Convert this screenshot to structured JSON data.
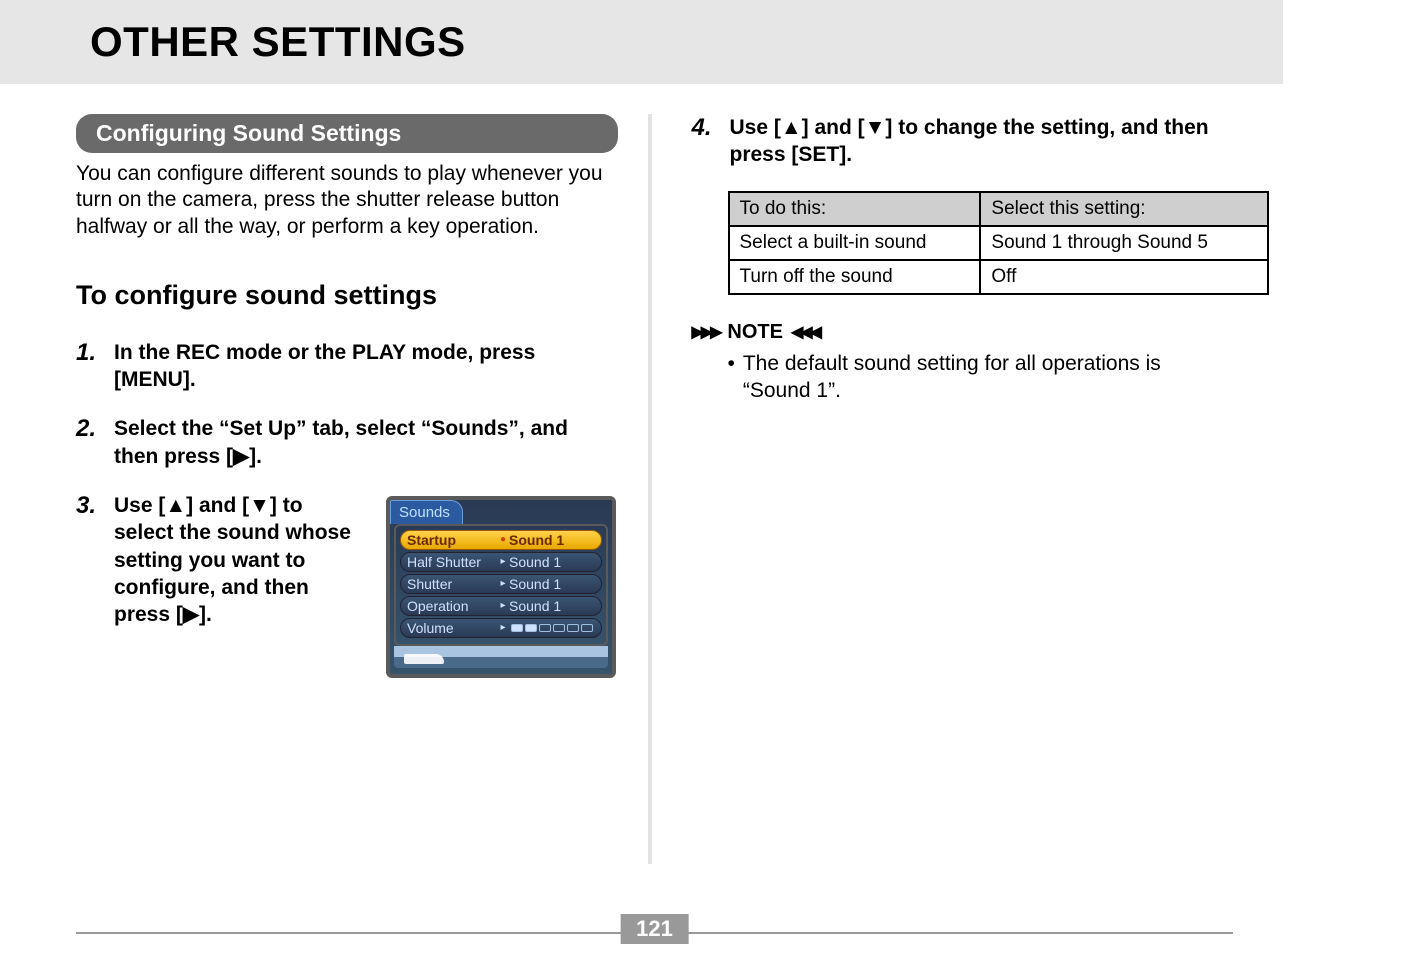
{
  "page": {
    "title": "OTHER SETTINGS",
    "number": "121"
  },
  "left": {
    "section_title": "Configuring Sound Settings",
    "intro": "You can configure different sounds to play whenever you turn on the camera, press the shutter release button halfway or all the way, or perform a key operation.",
    "subheading": "To configure sound settings",
    "steps": {
      "s1": {
        "num": "1.",
        "text": "In the REC mode or the PLAY mode, press [MENU]."
      },
      "s2": {
        "num": "2.",
        "text": "Select the “Set Up” tab, select “Sounds”, and then press [▶]."
      },
      "s3": {
        "num": "3.",
        "text": "Use [▲] and [▼] to select the sound whose setting you want to configure, and then press [▶]."
      }
    },
    "cam_menu": {
      "tab": "Sounds",
      "items": [
        {
          "label": "Startup",
          "value": "Sound 1",
          "selected": true
        },
        {
          "label": "Half Shutter",
          "value": "Sound 1",
          "selected": false
        },
        {
          "label": "Shutter",
          "value": "Sound 1",
          "selected": false
        },
        {
          "label": "Operation",
          "value": "Sound 1",
          "selected": false
        },
        {
          "label": "Volume",
          "value": "",
          "selected": false
        }
      ]
    }
  },
  "right": {
    "step4": {
      "num": "4.",
      "text": "Use [▲] and [▼] to change the setting, and then press [SET]."
    },
    "table": {
      "head": {
        "c1": "To do this:",
        "c2": "Select this setting:"
      },
      "rows": [
        {
          "c1": "Select a built-in sound",
          "c2": "Sound 1 through Sound 5"
        },
        {
          "c1": "Turn off the sound",
          "c2": "Off"
        }
      ]
    },
    "note": {
      "label": "NOTE",
      "text": "The default sound setting for all operations is “Sound 1”."
    }
  }
}
